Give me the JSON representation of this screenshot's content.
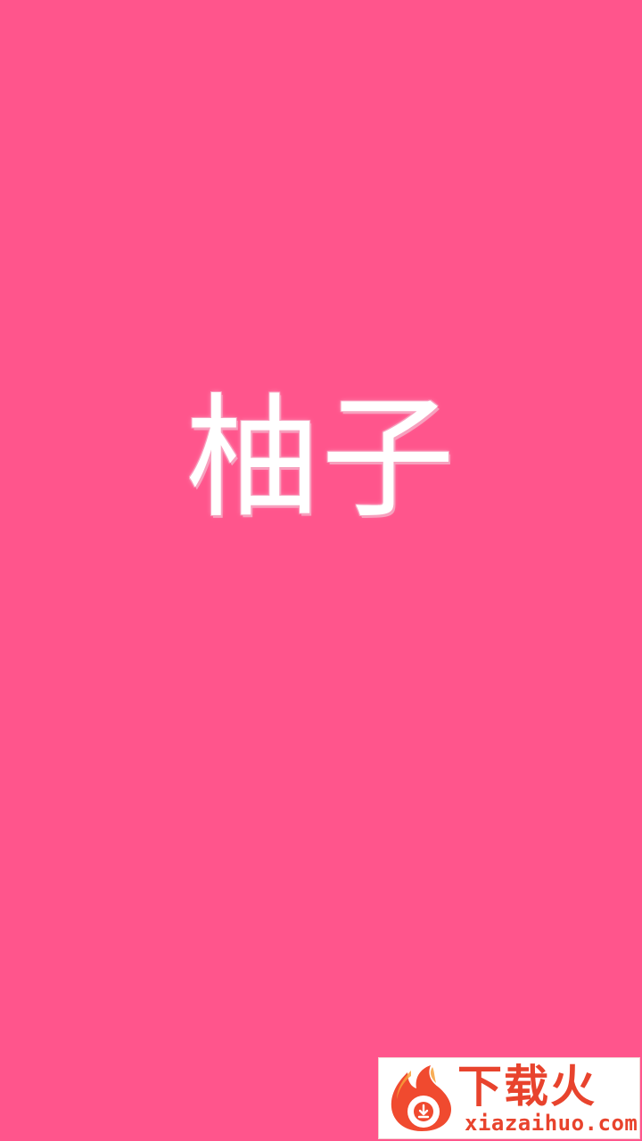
{
  "splash": {
    "background_color": "#FF558C",
    "title": "柚子"
  },
  "watermark": {
    "logo_icon": "flame-download-icon",
    "brand_cn": "下载火",
    "brand_en": "xiazaihuo.com",
    "brand_color": "#E8432D"
  }
}
